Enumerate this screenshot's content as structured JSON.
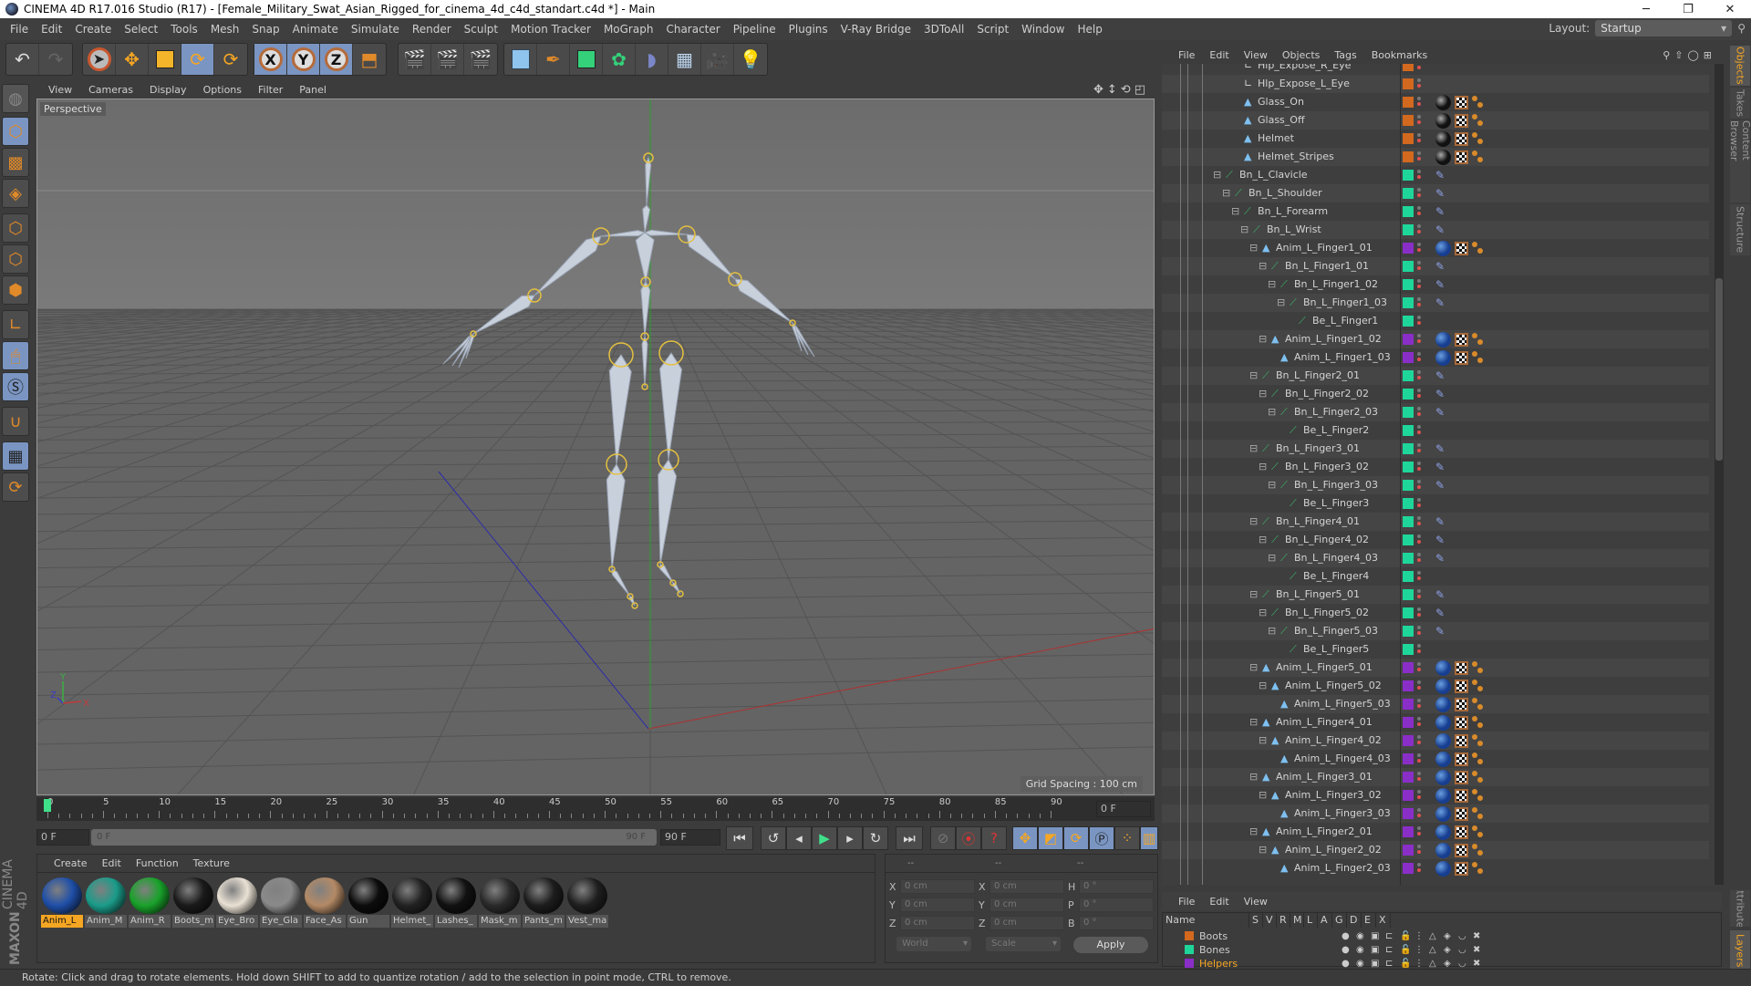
{
  "window": {
    "title": "CINEMA 4D R17.016 Studio (R17) - [Female_Military_Swat_Asian_Rigged_for_cinema_4d_c4d_standart.c4d *] - Main",
    "controls": [
      "minimize",
      "restore",
      "close"
    ]
  },
  "menubar": {
    "items": [
      "File",
      "Edit",
      "Create",
      "Select",
      "Tools",
      "Mesh",
      "Snap",
      "Animate",
      "Simulate",
      "Render",
      "Sculpt",
      "Motion Tracker",
      "MoGraph",
      "Character",
      "Pipeline",
      "Plugins",
      "V-Ray Bridge",
      "3DToAll",
      "Script",
      "Window",
      "Help"
    ],
    "layout_label": "Layout:",
    "layout_value": "Startup"
  },
  "toolbar": {
    "groups": [
      [
        "undo-icon",
        "redo-icon"
      ],
      [
        "live-selection-icon",
        "move-icon",
        "scale-icon",
        "rotate-icon",
        "recent-tool-icon"
      ],
      [
        "x-axis-icon",
        "y-axis-icon",
        "z-axis-icon",
        "coordinate-system-icon"
      ],
      [
        "render-view-icon",
        "render-picture-viewer-icon",
        "render-settings-icon"
      ],
      [
        "cube-icon",
        "pen-icon",
        "subdivision-icon",
        "cloner-icon",
        "deformer-icon",
        "floor-icon",
        "camera-icon",
        "light-icon"
      ]
    ],
    "active": [
      "rotate-icon",
      "x-axis-icon",
      "y-axis-icon",
      "z-axis-icon"
    ],
    "xyz_labels": [
      "X",
      "Y",
      "Z"
    ]
  },
  "lefttools": [
    "make-editable-icon",
    "model-mode-icon",
    "texture-mode-icon",
    "workplane-icon",
    "points-mode-icon",
    "edges-mode-icon",
    "polygons-mode-icon",
    "axis-mode-icon",
    "tweak-mode-icon",
    "solo-icon",
    "snap-icon",
    "workplane-lock-icon",
    "workplane-align-icon"
  ],
  "viewport": {
    "menu": [
      "View",
      "Cameras",
      "Display",
      "Options",
      "Filter",
      "Panel"
    ],
    "camera_label": "Perspective",
    "grid_spacing": "Grid Spacing : 100 cm",
    "axis_labels": {
      "x": "X",
      "y": "Y",
      "z": "Z"
    }
  },
  "timeline": {
    "ticks": [
      "0",
      "5",
      "10",
      "15",
      "20",
      "25",
      "30",
      "35",
      "40",
      "45",
      "50",
      "55",
      "60",
      "65",
      "70",
      "75",
      "80",
      "85",
      "90"
    ],
    "current_frame_field": "0 F",
    "start_field": "0 F",
    "range_start": "0 F",
    "range_end": "90 F",
    "end_field": "90 F",
    "end_field2": "90 F"
  },
  "materials": {
    "menu": [
      "Create",
      "Edit",
      "Function",
      "Texture"
    ],
    "items": [
      {
        "label": "Anim_L",
        "color": "#1f4fa8",
        "selected": true
      },
      {
        "label": "Anim_M",
        "color": "#1b9c8a"
      },
      {
        "label": "Anim_R",
        "color": "#19a22a"
      },
      {
        "label": "Boots_m",
        "color": "#1a1a1a"
      },
      {
        "label": "Eye_Bro",
        "color": "#e9e1d4"
      },
      {
        "label": "Eye_Gla",
        "color": "#8a8a8a"
      },
      {
        "label": "Face_As",
        "color": "#b48a66"
      },
      {
        "label": "Gun",
        "color": "#0c0c0c"
      },
      {
        "label": "Helmet_",
        "color": "#222"
      },
      {
        "label": "Lashes_",
        "color": "#111"
      },
      {
        "label": "Mask_m",
        "color": "#2a2a2a"
      },
      {
        "label": "Pants_m",
        "color": "#1d1d1d"
      },
      {
        "label": "Vest_ma",
        "color": "#1f1f1f"
      }
    ],
    "brand_1": "MAXON",
    "brand_2": "CINEMA 4D"
  },
  "coords": {
    "headers": [
      "--",
      "--",
      "--"
    ],
    "rows": [
      {
        "l1": "X",
        "v1": "0 cm",
        "l2": "X",
        "v2": "0 cm",
        "l3": "H",
        "v3": "0 °"
      },
      {
        "l1": "Y",
        "v1": "0 cm",
        "l2": "Y",
        "v2": "0 cm",
        "l3": "P",
        "v3": "0 °"
      },
      {
        "l1": "Z",
        "v1": "0 cm",
        "l2": "Z",
        "v2": "0 cm",
        "l3": "B",
        "v3": "0 °"
      }
    ],
    "space_select": "World",
    "mode_select": "Scale",
    "apply_label": "Apply"
  },
  "objects": {
    "menu": [
      "File",
      "Edit",
      "View",
      "Objects",
      "Tags",
      "Bookmarks"
    ],
    "rows": [
      {
        "name": "Hlp_Expose_R_Eye",
        "depth": 3,
        "type": "null",
        "layer": "#d2691e",
        "tags": ""
      },
      {
        "name": "Hlp_Expose_L_Eye",
        "depth": 3,
        "type": "null",
        "layer": "#d2691e",
        "tags": ""
      },
      {
        "name": "Glass_On",
        "depth": 3,
        "type": "poly",
        "layer": "#d2691e",
        "tags": "black"
      },
      {
        "name": "Glass_Off",
        "depth": 3,
        "type": "poly",
        "layer": "#d2691e",
        "tags": "black"
      },
      {
        "name": "Helmet",
        "depth": 3,
        "type": "poly",
        "layer": "#d2691e",
        "tags": "black"
      },
      {
        "name": "Helmet_Stripes",
        "depth": 3,
        "type": "poly",
        "layer": "#d2691e",
        "tags": "black"
      },
      {
        "name": "Bn_L_Clavicle",
        "depth": 1,
        "type": "bone",
        "layer": "#1fd69a",
        "tags": "ik",
        "fold": true
      },
      {
        "name": "Bn_L_Shoulder",
        "depth": 2,
        "type": "bone",
        "layer": "#1fd69a",
        "tags": "ik",
        "fold": true
      },
      {
        "name": "Bn_L_Forearm",
        "depth": 3,
        "type": "bone",
        "layer": "#1fd69a",
        "tags": "ik",
        "fold": true
      },
      {
        "name": "Bn_L_Wrist",
        "depth": 4,
        "type": "bone",
        "layer": "#1fd69a",
        "tags": "ik",
        "fold": true
      },
      {
        "name": "Anim_L_Finger1_01",
        "depth": 5,
        "type": "poly",
        "layer": "#8a2ec8",
        "tags": "blue",
        "fold": true
      },
      {
        "name": "Bn_L_Finger1_01",
        "depth": 6,
        "type": "bone",
        "layer": "#1fd69a",
        "tags": "ik",
        "fold": true
      },
      {
        "name": "Bn_L_Finger1_02",
        "depth": 7,
        "type": "bone",
        "layer": "#1fd69a",
        "tags": "ik",
        "fold": true
      },
      {
        "name": "Bn_L_Finger1_03",
        "depth": 8,
        "type": "bone",
        "layer": "#1fd69a",
        "tags": "ik",
        "fold": true
      },
      {
        "name": "Be_L_Finger1",
        "depth": 9,
        "type": "bone",
        "layer": "#1fd69a",
        "tags": ""
      },
      {
        "name": "Anim_L_Finger1_02",
        "depth": 6,
        "type": "poly",
        "layer": "#8a2ec8",
        "tags": "blue",
        "fold": true
      },
      {
        "name": "Anim_L_Finger1_03",
        "depth": 7,
        "type": "poly",
        "layer": "#8a2ec8",
        "tags": "blue"
      },
      {
        "name": "Bn_L_Finger2_01",
        "depth": 5,
        "type": "bone",
        "layer": "#1fd69a",
        "tags": "ik",
        "fold": true
      },
      {
        "name": "Bn_L_Finger2_02",
        "depth": 6,
        "type": "bone",
        "layer": "#1fd69a",
        "tags": "ik",
        "fold": true
      },
      {
        "name": "Bn_L_Finger2_03",
        "depth": 7,
        "type": "bone",
        "layer": "#1fd69a",
        "tags": "ik",
        "fold": true
      },
      {
        "name": "Be_L_Finger2",
        "depth": 8,
        "type": "bone",
        "layer": "#1fd69a",
        "tags": ""
      },
      {
        "name": "Bn_L_Finger3_01",
        "depth": 5,
        "type": "bone",
        "layer": "#1fd69a",
        "tags": "ik",
        "fold": true
      },
      {
        "name": "Bn_L_Finger3_02",
        "depth": 6,
        "type": "bone",
        "layer": "#1fd69a",
        "tags": "ik",
        "fold": true
      },
      {
        "name": "Bn_L_Finger3_03",
        "depth": 7,
        "type": "bone",
        "layer": "#1fd69a",
        "tags": "ik",
        "fold": true
      },
      {
        "name": "Be_L_Finger3",
        "depth": 8,
        "type": "bone",
        "layer": "#1fd69a",
        "tags": ""
      },
      {
        "name": "Bn_L_Finger4_01",
        "depth": 5,
        "type": "bone",
        "layer": "#1fd69a",
        "tags": "ik",
        "fold": true
      },
      {
        "name": "Bn_L_Finger4_02",
        "depth": 6,
        "type": "bone",
        "layer": "#1fd69a",
        "tags": "ik",
        "fold": true
      },
      {
        "name": "Bn_L_Finger4_03",
        "depth": 7,
        "type": "bone",
        "layer": "#1fd69a",
        "tags": "ik",
        "fold": true
      },
      {
        "name": "Be_L_Finger4",
        "depth": 8,
        "type": "bone",
        "layer": "#1fd69a",
        "tags": ""
      },
      {
        "name": "Bn_L_Finger5_01",
        "depth": 5,
        "type": "bone",
        "layer": "#1fd69a",
        "tags": "ik",
        "fold": true
      },
      {
        "name": "Bn_L_Finger5_02",
        "depth": 6,
        "type": "bone",
        "layer": "#1fd69a",
        "tags": "ik",
        "fold": true
      },
      {
        "name": "Bn_L_Finger5_03",
        "depth": 7,
        "type": "bone",
        "layer": "#1fd69a",
        "tags": "ik",
        "fold": true
      },
      {
        "name": "Be_L_Finger5",
        "depth": 8,
        "type": "bone",
        "layer": "#1fd69a",
        "tags": ""
      },
      {
        "name": "Anim_L_Finger5_01",
        "depth": 5,
        "type": "poly",
        "layer": "#8a2ec8",
        "tags": "blue",
        "fold": true
      },
      {
        "name": "Anim_L_Finger5_02",
        "depth": 6,
        "type": "poly",
        "layer": "#8a2ec8",
        "tags": "blue",
        "fold": true
      },
      {
        "name": "Anim_L_Finger5_03",
        "depth": 7,
        "type": "poly",
        "layer": "#8a2ec8",
        "tags": "blue"
      },
      {
        "name": "Anim_L_Finger4_01",
        "depth": 5,
        "type": "poly",
        "layer": "#8a2ec8",
        "tags": "blue",
        "fold": true
      },
      {
        "name": "Anim_L_Finger4_02",
        "depth": 6,
        "type": "poly",
        "layer": "#8a2ec8",
        "tags": "blue",
        "fold": true
      },
      {
        "name": "Anim_L_Finger4_03",
        "depth": 7,
        "type": "poly",
        "layer": "#8a2ec8",
        "tags": "blue"
      },
      {
        "name": "Anim_L_Finger3_01",
        "depth": 5,
        "type": "poly",
        "layer": "#8a2ec8",
        "tags": "blue",
        "fold": true
      },
      {
        "name": "Anim_L_Finger3_02",
        "depth": 6,
        "type": "poly",
        "layer": "#8a2ec8",
        "tags": "blue",
        "fold": true
      },
      {
        "name": "Anim_L_Finger3_03",
        "depth": 7,
        "type": "poly",
        "layer": "#8a2ec8",
        "tags": "blue"
      },
      {
        "name": "Anim_L_Finger2_01",
        "depth": 5,
        "type": "poly",
        "layer": "#8a2ec8",
        "tags": "blue",
        "fold": true
      },
      {
        "name": "Anim_L_Finger2_02",
        "depth": 6,
        "type": "poly",
        "layer": "#8a2ec8",
        "tags": "blue",
        "fold": true
      },
      {
        "name": "Anim_L_Finger2_03",
        "depth": 7,
        "type": "poly",
        "layer": "#8a2ec8",
        "tags": "blue"
      }
    ]
  },
  "righttabs": [
    "Objects",
    "Takes",
    "Content Browser",
    "Structure",
    "Attributes",
    "Layers"
  ],
  "layers": {
    "menu": [
      "File",
      "Edit",
      "View"
    ],
    "columns": [
      "Name",
      "S",
      "V",
      "R",
      "M",
      "L",
      "A",
      "G",
      "D",
      "E",
      "X"
    ],
    "rows": [
      {
        "name": "Boots",
        "color": "#d2691e",
        "selected": false
      },
      {
        "name": "Bones",
        "color": "#1fd69a",
        "selected": false
      },
      {
        "name": "Helpers",
        "color": "#8a2ec8",
        "selected": true
      }
    ]
  },
  "status": "Rotate: Click and drag to rotate elements. Hold down SHIFT to add to quantize rotation / add to the selection in point mode, CTRL to remove."
}
